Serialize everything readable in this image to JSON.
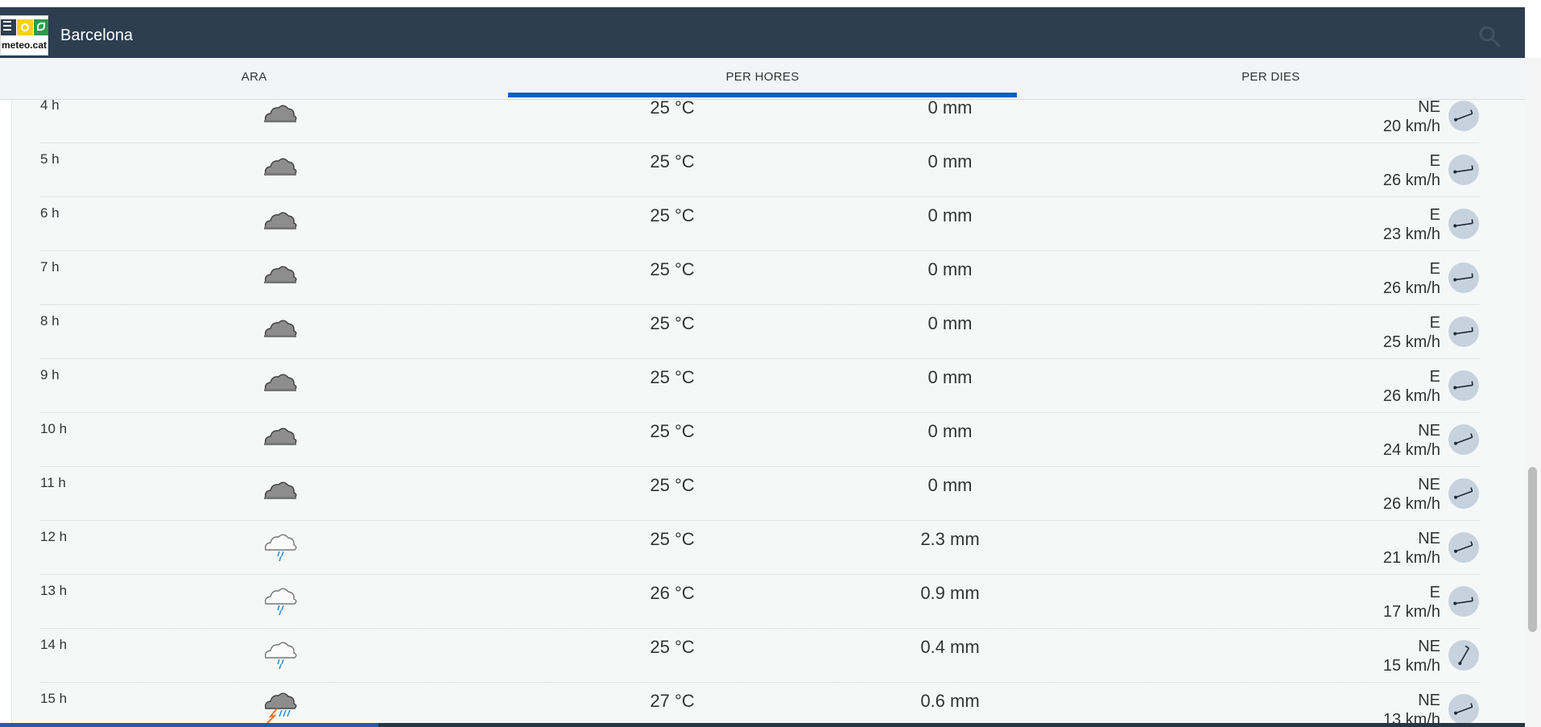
{
  "header": {
    "city": "Barcelona",
    "brand": "meteo.cat"
  },
  "tabs": [
    {
      "label": "ARA"
    },
    {
      "label": "PER HORES"
    },
    {
      "label": "PER DIES"
    }
  ],
  "rows": [
    {
      "hour": "4 h",
      "icon": "cloud-icon",
      "temp": "25 °C",
      "prec": "0 mm",
      "dir": "NE",
      "speed": "20 km/h"
    },
    {
      "hour": "5 h",
      "icon": "cloud-icon",
      "temp": "25 °C",
      "prec": "0 mm",
      "dir": "E",
      "speed": "26 km/h"
    },
    {
      "hour": "6 h",
      "icon": "cloud-icon",
      "temp": "25 °C",
      "prec": "0 mm",
      "dir": "E",
      "speed": "23 km/h"
    },
    {
      "hour": "7 h",
      "icon": "cloud-icon",
      "temp": "25 °C",
      "prec": "0 mm",
      "dir": "E",
      "speed": "26 km/h"
    },
    {
      "hour": "8 h",
      "icon": "cloud-icon",
      "temp": "25 °C",
      "prec": "0 mm",
      "dir": "E",
      "speed": "25 km/h"
    },
    {
      "hour": "9 h",
      "icon": "cloud-icon",
      "temp": "25 °C",
      "prec": "0 mm",
      "dir": "E",
      "speed": "26 km/h"
    },
    {
      "hour": "10 h",
      "icon": "cloud-icon",
      "temp": "25 °C",
      "prec": "0 mm",
      "dir": "NE",
      "speed": "24 km/h"
    },
    {
      "hour": "11 h",
      "icon": "cloud-icon",
      "temp": "25 °C",
      "prec": "0 mm",
      "dir": "NE",
      "speed": "26 km/h"
    },
    {
      "hour": "12 h",
      "icon": "rain-cloud-icon",
      "temp": "25 °C",
      "prec": "2.3 mm",
      "dir": "NE",
      "speed": "21 km/h"
    },
    {
      "hour": "13 h",
      "icon": "rain-cloud-icon",
      "temp": "26 °C",
      "prec": "0.9 mm",
      "dir": "E",
      "speed": "17 km/h"
    },
    {
      "hour": "14 h",
      "icon": "rain-cloud-icon",
      "temp": "25 °C",
      "prec": "0.4 mm",
      "dir": "NE",
      "speed": "15 km/h"
    },
    {
      "hour": "15 h",
      "icon": "storm-cloud-icon",
      "temp": "27 °C",
      "prec": "0.6 mm",
      "dir": "NE",
      "speed": "13 km/h"
    }
  ]
}
